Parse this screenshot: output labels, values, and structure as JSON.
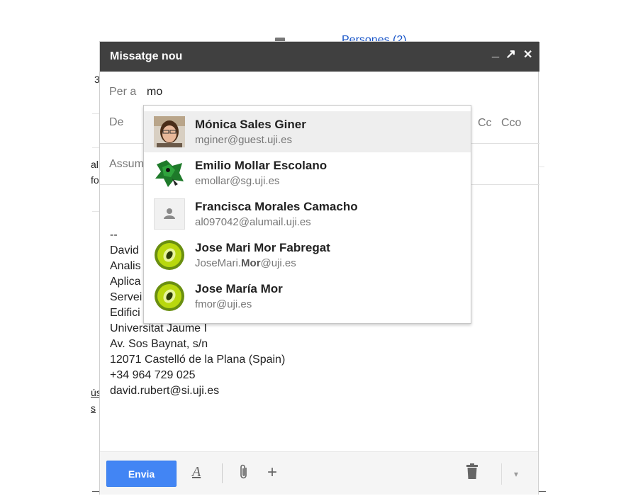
{
  "background": {
    "people_link": "Persones (2)",
    "left_fragments": [
      "3",
      "al",
      "fo"
    ],
    "bottom_left_fragments": [
      "ús",
      "s"
    ]
  },
  "compose": {
    "title": "Missatge nou",
    "controls": {
      "minimize": "_",
      "popout": "↗",
      "close": "✕"
    },
    "to_label": "Per a",
    "to_value": "mo",
    "from_label": "De",
    "cc_label": "Cc",
    "bcc_label": "Cco",
    "subject_placeholder": "Assumpte",
    "signature_lines": [
      "--",
      "David",
      "Analis",
      "Aplica",
      "Servei",
      "Edifici",
      "Universitat Jaume I",
      "Av. Sos Baynat, s/n",
      "12071 Castelló de la Plana (Spain)",
      "+34 964 729 025",
      "david.rubert@si.uji.es"
    ],
    "toolbar": {
      "send_label": "Envia",
      "format_label": "A",
      "add_label": "+",
      "more_label": "▾"
    }
  },
  "suggestions": [
    {
      "name": "Mónica Sales Giner",
      "email": "mginer@guest.uji.es",
      "avatar": "photo-avatar",
      "selected": true
    },
    {
      "name": "Emilio Mollar Escolano",
      "email": "emollar@sg.uji.es",
      "avatar": "cartoon-avatar",
      "selected": false
    },
    {
      "name": "Francisca Morales Camacho",
      "email": "al097042@alumail.uji.es",
      "avatar": "default-person-avatar",
      "selected": false
    },
    {
      "name": "Jose Mari Mor Fabregat",
      "email_prefix": "JoseMari.",
      "email_match": "Mor",
      "email_suffix": "@uji.es",
      "avatar": "kiwi-avatar",
      "selected": false
    },
    {
      "name": "Jose María Mor",
      "email": "fmor@uji.es",
      "avatar": "kiwi-avatar",
      "selected": false
    }
  ],
  "colors": {
    "titlebar": "#404040",
    "send_button": "#4285f4",
    "selected_row": "#eeeeee"
  }
}
